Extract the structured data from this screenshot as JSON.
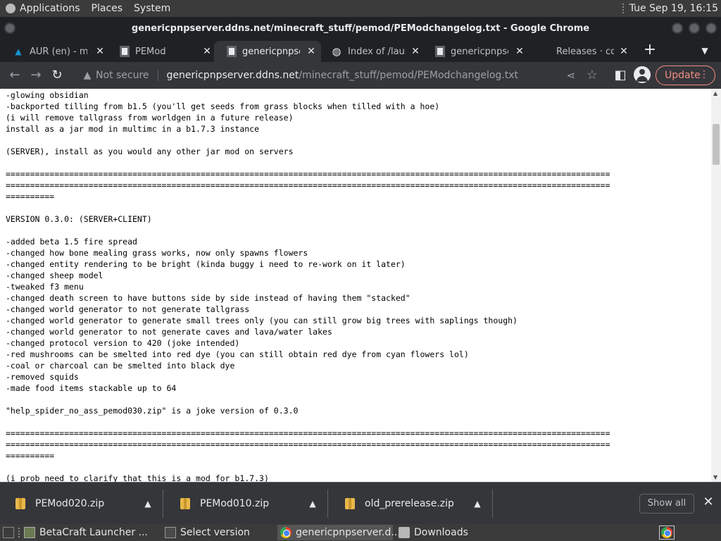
{
  "top_panel": {
    "menus": [
      "Applications",
      "Places",
      "System"
    ],
    "clock": "Tue Sep 19, 16:15"
  },
  "window": {
    "title": "genericpnpserver.ddns.net/minecraft_stuff/pemod/PEModchangelog.txt - Google Chrome"
  },
  "tabs": [
    {
      "label": "AUR (en) - mir",
      "icon": "arch-icon"
    },
    {
      "label": "PEMod",
      "icon": "page-icon"
    },
    {
      "label": "genericpnpser",
      "icon": "page-icon"
    },
    {
      "label": "Index of /launc",
      "icon": "globe-icon"
    },
    {
      "label": "genericpnpser",
      "icon": "page-icon"
    },
    {
      "label": "Releases · coff",
      "icon": "github-icon"
    }
  ],
  "toolbar": {
    "security_label": "Not secure",
    "url_host": "genericpnpserver.ddns.net",
    "url_path": "/minecraft_stuff/pemod/PEModchangelog.txt",
    "update_label": "Update"
  },
  "changelog_text": "-glowing obsidian\n-backported tilling from b1.5 (you'll get seeds from grass blocks when tilled with a hoe)\n(i will remove tallgrass from worldgen in a future release)\ninstall as a jar mod in multimc in a b1.7.3 instance\n\n(SERVER), install as you would any other jar mod on servers\n\n============================================================================================================================\n============================================================================================================================\n==========\n\nVERSION 0.3.0: (SERVER+CLIENT)\n\n-added beta 1.5 fire spread\n-changed how bone mealing grass works, now only spawns flowers\n-changed entity rendering to be bright (kinda buggy i need to re-work on it later)\n-changed sheep model\n-tweaked f3 menu\n-changed death screen to have buttons side by side instead of having them \"stacked\"\n-changed world generator to not generate tallgrass\n-changed world generator to generate small trees only (you can still grow big trees with saplings though)\n-changed world generator to not generate caves and lava/water lakes\n-changed protocol version to 420 (joke intended)\n-red mushrooms can be smelted into red dye (you can still obtain red dye from cyan flowers lol)\n-coal or charcoal can be smelted into black dye\n-removed squids\n-made food items stackable up to 64\n\n\"help_spider_no_ass_pemod030.zip\" is a joke version of 0.3.0\n\n============================================================================================================================\n============================================================================================================================\n==========\n\n(i prob need to clarify that this is a mod for b1.7.3)",
  "downloads": [
    {
      "name": "PEMod020.zip"
    },
    {
      "name": "PEMod010.zip"
    },
    {
      "name": "old_prerelease.zip"
    }
  ],
  "downloads_show_all": "Show all",
  "taskbar": [
    {
      "label": "BetaCraft Launcher ...",
      "icon": "betacraft-icon"
    },
    {
      "label": "Select version",
      "icon": "window-icon"
    },
    {
      "label": "genericpnpserver.d...",
      "icon": "chrome-icon"
    },
    {
      "label": "Downloads",
      "icon": "folder-icon"
    }
  ],
  "colors": {
    "chrome_dark": "#202124",
    "toolbar": "#35363a",
    "update_accent": "#f28b82"
  }
}
